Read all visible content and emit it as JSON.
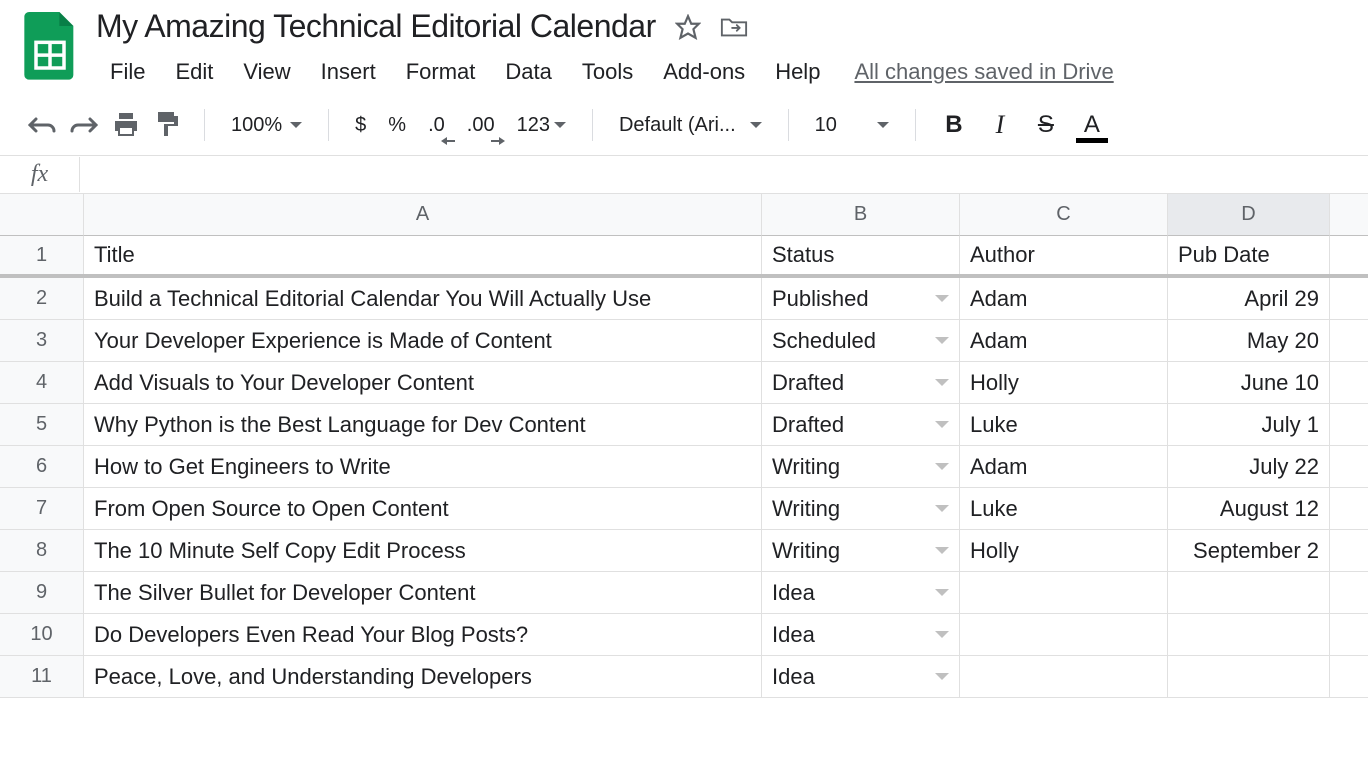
{
  "doc": {
    "title": "My Amazing Technical Editorial Calendar",
    "save_status": "All changes saved in Drive"
  },
  "menus": [
    "File",
    "Edit",
    "View",
    "Insert",
    "Format",
    "Data",
    "Tools",
    "Add-ons",
    "Help"
  ],
  "toolbar": {
    "zoom": "100%",
    "currency": "$",
    "percent": "%",
    "dec_dec": ".0",
    "inc_dec": ".00",
    "num_fmt": "123",
    "font": "Default (Ari...",
    "font_size": "10",
    "bold": "B",
    "italic": "I",
    "strike": "S",
    "text_color": "A"
  },
  "columns": [
    {
      "letter": "A",
      "label": "Title",
      "active": false
    },
    {
      "letter": "B",
      "label": "Status",
      "active": false
    },
    {
      "letter": "C",
      "label": "Author",
      "active": false
    },
    {
      "letter": "D",
      "label": "Pub Date",
      "active": true
    }
  ],
  "rows": [
    {
      "n": "2",
      "title": "Build a Technical Editorial Calendar You Will Actually Use",
      "status": "Published",
      "author": "Adam",
      "pub": "April 29"
    },
    {
      "n": "3",
      "title": "Your Developer Experience is Made of Content",
      "status": "Scheduled",
      "author": "Adam",
      "pub": "May 20"
    },
    {
      "n": "4",
      "title": "Add Visuals to Your Developer Content",
      "status": "Drafted",
      "author": "Holly",
      "pub": "June 10"
    },
    {
      "n": "5",
      "title": "Why Python is the Best Language for Dev Content",
      "status": "Drafted",
      "author": "Luke",
      "pub": "July 1"
    },
    {
      "n": "6",
      "title": "How to Get Engineers to Write",
      "status": "Writing",
      "author": "Adam",
      "pub": "July 22"
    },
    {
      "n": "7",
      "title": "From Open Source to Open Content",
      "status": "Writing",
      "author": "Luke",
      "pub": "August 12"
    },
    {
      "n": "8",
      "title": "The 10 Minute Self Copy Edit Process",
      "status": "Writing",
      "author": "Holly",
      "pub": "September 2"
    },
    {
      "n": "9",
      "title": "The Silver Bullet for Developer Content",
      "status": "Idea",
      "author": "",
      "pub": ""
    },
    {
      "n": "10",
      "title": "Do Developers Even Read Your Blog Posts?",
      "status": "Idea",
      "author": "",
      "pub": ""
    },
    {
      "n": "11",
      "title": "Peace, Love, and Understanding Developers",
      "status": "Idea",
      "author": "",
      "pub": ""
    }
  ]
}
